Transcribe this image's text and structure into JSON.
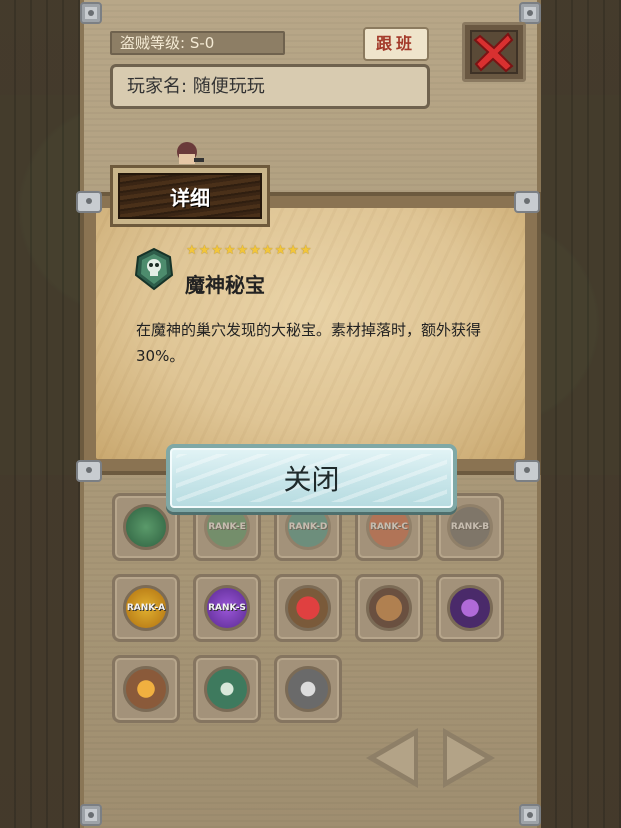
{
  "header": {
    "thief_rank_label": "盗贼等级: S-0",
    "team_button_label": "跟班",
    "player_name_label": "玩家名: 随便玩玩",
    "close_x_icon": "red-x-icon"
  },
  "dialog": {
    "title": "详细",
    "item": {
      "icon": "skull-emblem-icon",
      "stars": "★★★★★★★★★★",
      "star_count": 10,
      "name": "魔神秘宝",
      "description": "在魔神的巢穴发现的大秘宝。素材掉落时，额外获得30%。"
    },
    "close_button_label": "关闭"
  },
  "badges": [
    {
      "icon": "green-rock-icon",
      "label": "",
      "active": true
    },
    {
      "icon": "rank-e-fist-icon",
      "label": "RANK-E",
      "active": false
    },
    {
      "icon": "rank-d-fist-icon",
      "label": "RANK-D",
      "active": false
    },
    {
      "icon": "rank-c-fist-icon",
      "label": "RANK-C",
      "active": false
    },
    {
      "icon": "rank-b-fist-icon",
      "label": "RANK-B",
      "active": false
    },
    {
      "icon": "rank-a-fist-icon",
      "label": "RANK-A",
      "active": true
    },
    {
      "icon": "rank-s-fist-icon",
      "label": "RANK-S",
      "active": true
    },
    {
      "icon": "potion-icon",
      "label": "",
      "active": true
    },
    {
      "icon": "money-bag-icon",
      "label": "",
      "active": true
    },
    {
      "icon": "purple-star-icon",
      "label": "",
      "active": true
    },
    {
      "icon": "fire-staff-icon",
      "label": "",
      "active": true
    },
    {
      "icon": "skull-emblem-icon",
      "label": "",
      "active": true
    },
    {
      "icon": "crossed-swords-icon",
      "label": "",
      "active": true
    }
  ],
  "navigation": {
    "prev_icon": "left-arrow-icon",
    "next_icon": "right-arrow-icon"
  },
  "colors": {
    "accent_red": "#d93030",
    "star_gold": "#f3c63a"
  }
}
